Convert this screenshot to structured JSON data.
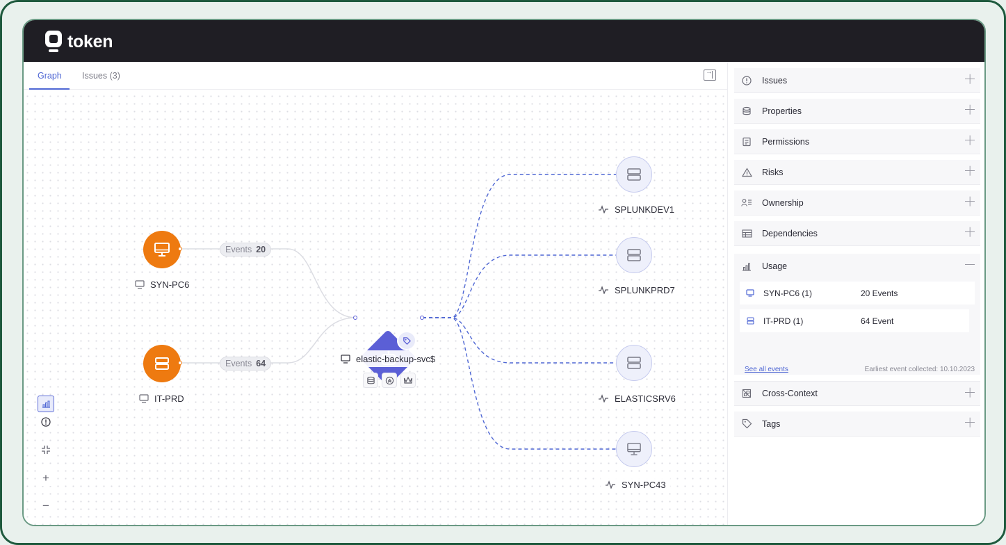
{
  "app": {
    "name": "token"
  },
  "tabs": {
    "graph": "Graph",
    "issues": "Issues (3)"
  },
  "graph": {
    "sources": [
      {
        "name": "SYN-PC6",
        "edge_label": "Events",
        "edge_count": "20",
        "icon": "monitor-icon"
      },
      {
        "name": "IT-PRD",
        "edge_label": "Events",
        "edge_count": "64",
        "icon": "server-icon"
      }
    ],
    "center": {
      "name": "elastic-backup-svc$",
      "icon": "robot-icon",
      "badge": "tag-icon"
    },
    "targets": [
      {
        "name": "SPLUNKDEV1",
        "icon": "server-icon"
      },
      {
        "name": "SPLUNKPRD7",
        "icon": "server-icon"
      },
      {
        "name": "ELASTICSRV6",
        "icon": "server-icon"
      },
      {
        "name": "SYN-PC43",
        "icon": "monitor-icon"
      }
    ]
  },
  "panel": {
    "sections": [
      {
        "title": "Issues",
        "icon": "alert-circle-icon",
        "state": "collapsed"
      },
      {
        "title": "Properties",
        "icon": "database-icon",
        "state": "collapsed"
      },
      {
        "title": "Permissions",
        "icon": "document-icon",
        "state": "collapsed"
      },
      {
        "title": "Risks",
        "icon": "warning-icon",
        "state": "collapsed"
      },
      {
        "title": "Ownership",
        "icon": "user-list-icon",
        "state": "collapsed"
      },
      {
        "title": "Dependencies",
        "icon": "grid-icon",
        "state": "collapsed"
      },
      {
        "title": "Usage",
        "icon": "bar-chart-icon",
        "state": "expanded"
      },
      {
        "title": "Cross-Context",
        "icon": "cross-context-icon",
        "state": "collapsed"
      },
      {
        "title": "Tags",
        "icon": "tag-icon",
        "state": "collapsed"
      }
    ],
    "usage": {
      "rows": [
        {
          "name": "SYN-PC6 (1)",
          "count": "20 Events"
        },
        {
          "name": "IT-PRD (1)",
          "count": "64 Event"
        }
      ],
      "see_all": "See all events",
      "earliest": "Earliest event collected: 10.10.2023"
    }
  },
  "colors": {
    "accent": "#5b5fd6",
    "source_node": "#ee7a10",
    "link": "#4f67d4",
    "topbar": "#1f1e24"
  }
}
